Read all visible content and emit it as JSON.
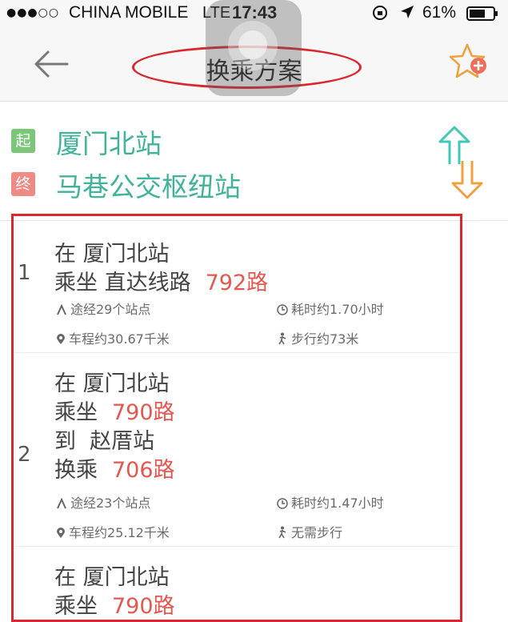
{
  "status_bar": {
    "signal": "●●●○○",
    "carrier": "CHINA MOBILE",
    "network": "LTE",
    "time": "17:43",
    "battery": "61%"
  },
  "nav": {
    "title": "换乘方案"
  },
  "stations": {
    "start_tag": "起",
    "start": "厦门北站",
    "end_tag": "终",
    "end": "马巷公交枢纽站"
  },
  "routes": [
    {
      "index": "1",
      "lines": [
        {
          "text": "在 厦门北站",
          "route": ""
        },
        {
          "text": "乘坐 直达线路",
          "route": "792路"
        }
      ],
      "stops": "途经29个站点",
      "duration": "耗时约1.70小时",
      "distance": "车程约30.67千米",
      "walk": "步行约73米"
    },
    {
      "index": "2",
      "lines": [
        {
          "text": "在 厦门北站",
          "route": ""
        },
        {
          "text": "乘坐",
          "route": "790路"
        },
        {
          "text": "到  赵厝站",
          "route": ""
        },
        {
          "text": "换乘",
          "route": "706路"
        }
      ],
      "stops": "途经23个站点",
      "duration": "耗时约1.47小时",
      "distance": "车程约25.12千米",
      "walk": "无需步行"
    },
    {
      "index": "",
      "lines": [
        {
          "text": "在 厦门北站",
          "route": ""
        },
        {
          "text": "乘坐",
          "route": "790路"
        }
      ]
    }
  ],
  "colors": {
    "accent_green": "#41b39a",
    "route_red": "#e6574f",
    "annotation_red": "#d9282f",
    "start_tag": "#7cc67a",
    "end_tag": "#ef8a84"
  },
  "icons": [
    "back-arrow-icon",
    "favorite-add-icon",
    "swap-icon",
    "stops-icon",
    "clock-icon",
    "location-pin-icon",
    "walk-icon"
  ]
}
